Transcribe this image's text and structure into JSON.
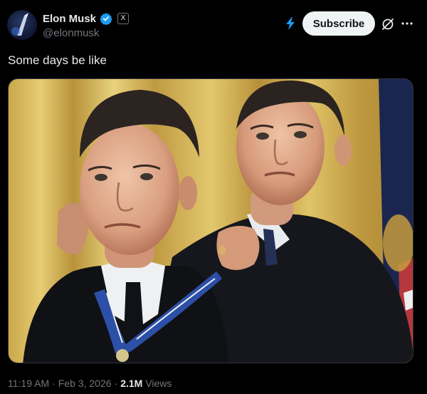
{
  "author": {
    "display_name": "Elon Musk",
    "handle": "@elonmusk",
    "verified": true,
    "affiliate_badge": "X"
  },
  "actions": {
    "subscribe_label": "Subscribe"
  },
  "post": {
    "text": "Some days be like",
    "time": "11:19 AM",
    "date": "Feb 3, 2026",
    "views_count": "2.1M",
    "views_label": "Views",
    "separator": "·"
  },
  "icons": {
    "verified": "verified-badge-icon",
    "spark": "lightning-icon",
    "grok": "grok-icon",
    "more": "more-dots-icon"
  },
  "colors": {
    "background": "#000000",
    "text_primary": "#e7e9ea",
    "text_secondary": "#71767b",
    "verified_blue": "#1d9bf0",
    "subscribe_bg": "#eff3f4"
  }
}
